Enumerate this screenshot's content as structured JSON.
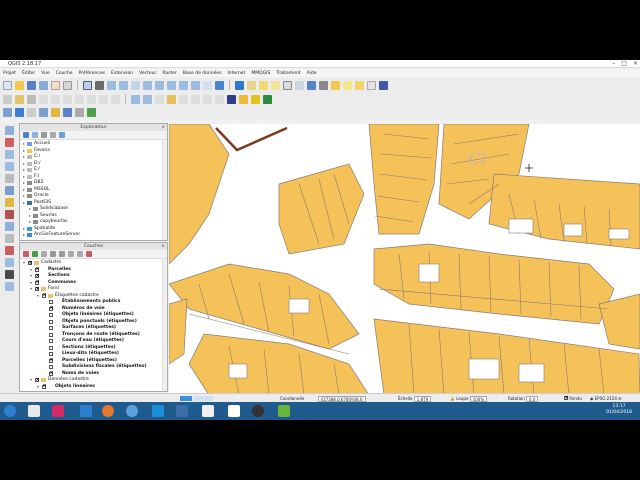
{
  "window": {
    "title": "QGIS 2.18.17"
  },
  "menubar": {
    "items": [
      "Projet",
      "Éditer",
      "Vue",
      "Couche",
      "Préférences",
      "Extension",
      "Vecteur",
      "Raster",
      "Base de données",
      "Internet",
      "MMQGIS",
      "Traitement",
      "Aide"
    ]
  },
  "explorer": {
    "title": "Explorateur",
    "items": [
      {
        "label": "Accueil",
        "icon": "home-icon"
      },
      {
        "label": "Favoris",
        "icon": "star-icon"
      },
      {
        "label": "C:/",
        "icon": "drive-icon"
      },
      {
        "label": "D:/",
        "icon": "drive-icon"
      },
      {
        "label": "E:/",
        "icon": "drive-icon"
      },
      {
        "label": "F:/",
        "icon": "drive-icon"
      },
      {
        "label": "DB2",
        "icon": "database-icon"
      },
      {
        "label": "MSSQL",
        "icon": "database-icon"
      },
      {
        "label": "Oracle",
        "icon": "database-icon"
      },
      {
        "label": "PostGIS",
        "icon": "elephant-icon"
      },
      {
        "label": "Solidsiabase",
        "icon": "database-icon",
        "indent": 1
      },
      {
        "label": "Seurlas",
        "icon": "database-icon",
        "indent": 1
      },
      {
        "label": "copybeurlas",
        "icon": "database-icon",
        "indent": 1
      },
      {
        "label": "Spatialite",
        "icon": "feather-icon"
      },
      {
        "label": "ArcGisFeatureServer",
        "icon": "globe-icon"
      }
    ]
  },
  "layers": {
    "title": "Couches",
    "items": [
      {
        "label": "Cadastre",
        "level": 0,
        "checked": true,
        "bold": false
      },
      {
        "label": "Parcelles",
        "level": 1,
        "checked": true,
        "bold": true
      },
      {
        "label": "Sections",
        "level": 1,
        "checked": true,
        "bold": true
      },
      {
        "label": "Communes",
        "level": 1,
        "checked": true,
        "bold": true
      },
      {
        "label": "Fond",
        "level": 1,
        "checked": true,
        "bold": false
      },
      {
        "label": "Étiquettes cadastre",
        "level": 2,
        "checked": true,
        "bold": false
      },
      {
        "label": "Établissements publics",
        "level": 3,
        "checked": false,
        "bold": true
      },
      {
        "label": "Numéros de voie",
        "level": 3,
        "checked": true,
        "bold": true
      },
      {
        "label": "Objets linéaires (étiquettes)",
        "level": 3,
        "checked": false,
        "bold": true
      },
      {
        "label": "Objets ponctuels (étiquettes)",
        "level": 3,
        "checked": false,
        "bold": true
      },
      {
        "label": "Surfaces (étiquettes)",
        "level": 3,
        "checked": false,
        "bold": true
      },
      {
        "label": "Tronçons de route (étiquettes)",
        "level": 3,
        "checked": false,
        "bold": true
      },
      {
        "label": "Cours d'eau (étiquettes)",
        "level": 3,
        "checked": false,
        "bold": true
      },
      {
        "label": "Sections (étiquettes)",
        "level": 3,
        "checked": false,
        "bold": true
      },
      {
        "label": "Lieux-dits (étiquettes)",
        "level": 3,
        "checked": false,
        "bold": true
      },
      {
        "label": "Parcelles (étiquettes)",
        "level": 3,
        "checked": true,
        "bold": true
      },
      {
        "label": "Subdivisions fiscales (étiquettes)",
        "level": 3,
        "checked": false,
        "bold": true
      },
      {
        "label": "Noms de voies",
        "level": 3,
        "checked": true,
        "bold": true
      },
      {
        "label": "Données cadastre",
        "level": 1,
        "checked": true,
        "bold": false
      },
      {
        "label": "Objets lineaires",
        "level": 2,
        "checked": true,
        "bold": true
      }
    ]
  },
  "map": {
    "label": "CI",
    "fill_color": "#f5c25a",
    "stroke_color": "#8c7a72",
    "border_color": "#7a3a1e"
  },
  "statusbar": {
    "coord_label": "Coordonnée",
    "coord_value": "437388.0,6780938.6",
    "scale_label": "Échelle",
    "scale_value": "1:879",
    "zoom_label": "Loupe",
    "zoom_value": "100%",
    "rotation_label": "Rotation",
    "rotation_value": "0,0",
    "render_label": "Rendu",
    "crs": "EPSG:2154"
  },
  "taskbar": {
    "time": "13:17",
    "date": "01/04/2018"
  },
  "colors": {
    "parcel_fill": "#f5c25a",
    "taskbar": "#1f5b8c"
  }
}
